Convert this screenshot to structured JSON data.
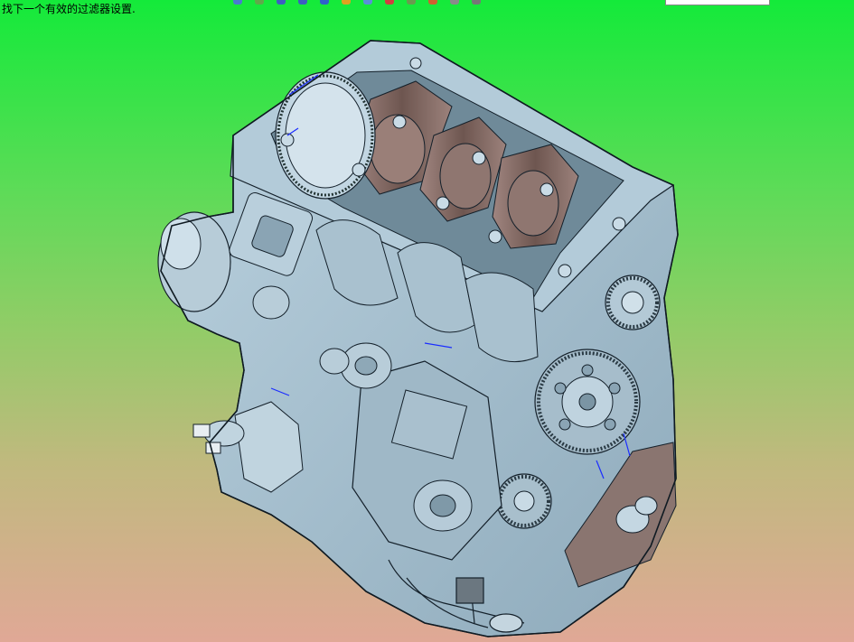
{
  "status": {
    "prompt": "找下一个有效的过滤器设置."
  },
  "toolbar": {
    "icons": [
      {
        "name": "tool-icon-1",
        "color": "#4a7bd0"
      },
      {
        "name": "tool-icon-2",
        "color": "#62a84b"
      },
      {
        "name": "tool-icon-3",
        "color": "#3d5ec2"
      },
      {
        "name": "tool-icon-4",
        "color": "#3d5ec2"
      },
      {
        "name": "tool-icon-5",
        "color": "#2f62c9"
      },
      {
        "name": "tool-icon-6",
        "color": "#e0a020"
      },
      {
        "name": "tool-icon-7",
        "color": "#5a8fd8"
      },
      {
        "name": "tool-icon-8",
        "color": "#d04040"
      },
      {
        "name": "tool-icon-9",
        "color": "#6a9a50"
      },
      {
        "name": "tool-icon-10",
        "color": "#d06030"
      },
      {
        "name": "tool-icon-11",
        "color": "#8a8a8a"
      },
      {
        "name": "tool-icon-12",
        "color": "#777777"
      }
    ]
  },
  "model": {
    "body_color": "#a8c2d2",
    "shade_color": "#7d9aac",
    "edge_color": "#14202a",
    "crank_color": "#8a6e66",
    "gear_color": "#9fb6c4",
    "gradient_top": "#14ea3a",
    "gradient_bottom": "#e0a896"
  }
}
